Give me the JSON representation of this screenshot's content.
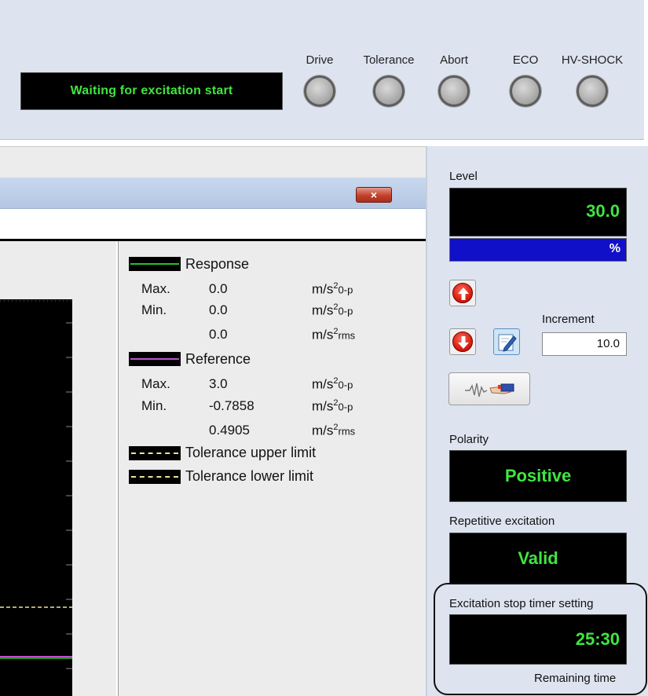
{
  "status": {
    "message": "Waiting for excitation start"
  },
  "indicators": [
    {
      "label": "Drive"
    },
    {
      "label": "Tolerance"
    },
    {
      "label": "Abort"
    },
    {
      "label": "ECO"
    },
    {
      "label": "HV-SHOCK"
    }
  ],
  "window": {
    "close_symbol": "×"
  },
  "legend": {
    "response": {
      "name": "Response",
      "color": "#22c322",
      "rows": [
        {
          "label": "Max.",
          "value": "0.0",
          "unit_base": "m/s",
          "unit_exp": "2",
          "unit_suffix": "0-p"
        },
        {
          "label": "Min.",
          "value": "0.0",
          "unit_base": "m/s",
          "unit_exp": "2",
          "unit_suffix": "0-p"
        },
        {
          "label": "",
          "value": "0.0",
          "unit_base": "m/s",
          "unit_exp": "2",
          "unit_suffix": "rms"
        }
      ]
    },
    "reference": {
      "name": "Reference",
      "color": "#c04fd4",
      "rows": [
        {
          "label": "Max.",
          "value": "3.0",
          "unit_base": "m/s",
          "unit_exp": "2",
          "unit_suffix": "0-p"
        },
        {
          "label": "Min.",
          "value": "-0.7858",
          "unit_base": "m/s",
          "unit_exp": "2",
          "unit_suffix": "0-p"
        },
        {
          "label": "",
          "value": "0.4905",
          "unit_base": "m/s",
          "unit_exp": "2",
          "unit_suffix": "rms"
        }
      ]
    },
    "tolerance_upper": "Tolerance upper limit",
    "tolerance_lower": "Tolerance lower limit",
    "tolerance_color": "#f0e29a"
  },
  "control": {
    "level_label": "Level",
    "level_value": "30.0",
    "level_percent": 30,
    "level_unit": "%",
    "increment_label": "Increment",
    "increment_value": "10.0",
    "polarity_label": "Polarity",
    "polarity_value": "Positive",
    "repetitive_label": "Repetitive excitation",
    "repetitive_value": "Valid",
    "timer_label": "Excitation stop timer setting",
    "timer_value": "25:30",
    "remaining_label": "Remaining time"
  },
  "colors": {
    "accent_green": "#3fe63f",
    "level_bar": "#1010c8",
    "panel_bg": "#dde4f0"
  }
}
